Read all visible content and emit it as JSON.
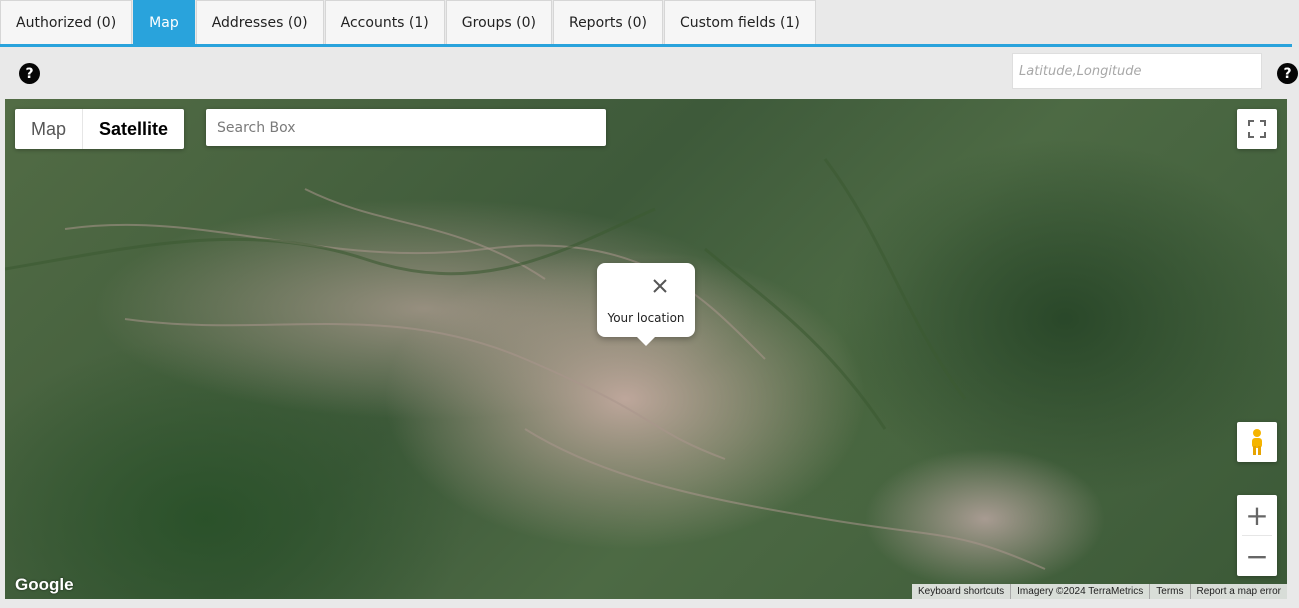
{
  "tabs": [
    {
      "label": "Authorized (0)",
      "active": false
    },
    {
      "label": "Map",
      "active": true
    },
    {
      "label": "Addresses (0)",
      "active": false
    },
    {
      "label": "Accounts (1)",
      "active": false
    },
    {
      "label": "Groups (0)",
      "active": false
    },
    {
      "label": "Reports (0)",
      "active": false
    },
    {
      "label": "Custom fields (1)",
      "active": false
    }
  ],
  "help": {
    "symbol": "?"
  },
  "coords": {
    "placeholder": "Latitude,Longitude"
  },
  "map": {
    "type_buttons": {
      "map": "Map",
      "satellite": "Satellite"
    },
    "search_placeholder": "Search Box",
    "popup_text": "Your location",
    "zoom_in": "+",
    "zoom_out": "−",
    "logo": "Google",
    "attribution": {
      "shortcuts": "Keyboard shortcuts",
      "imagery": "Imagery ©2024 TerraMetrics",
      "terms": "Terms",
      "report": "Report a map error"
    }
  },
  "colors": {
    "accent": "#29a3dc"
  }
}
